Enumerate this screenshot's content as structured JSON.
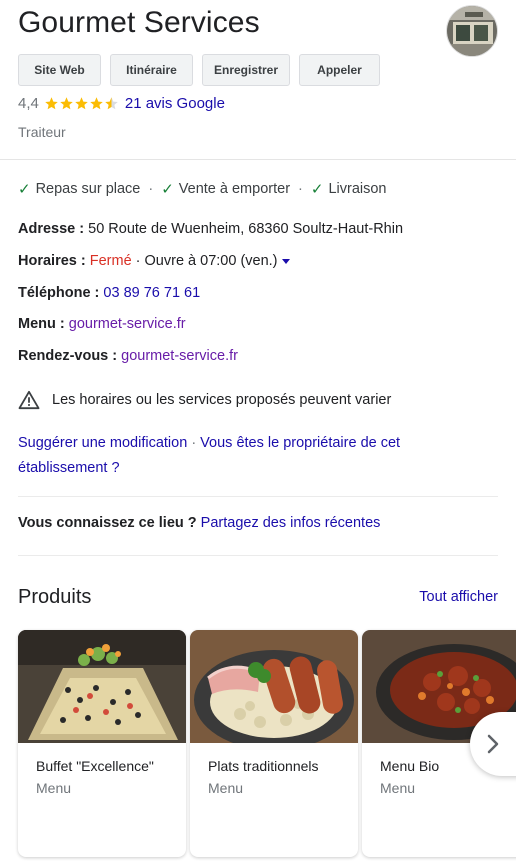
{
  "header": {
    "title": "Gourmet Services"
  },
  "actions": {
    "website": "Site Web",
    "directions": "Itinéraire",
    "save": "Enregistrer",
    "call": "Appeler"
  },
  "rating": {
    "value": "4,4",
    "stars": 4.4,
    "reviews_link": "21 avis Google"
  },
  "category": "Traiteur",
  "services": {
    "items": [
      "Repas sur place",
      "Vente à emporter",
      "Livraison"
    ]
  },
  "info": {
    "address_label": "Adresse : ",
    "address_value": "50 Route de Wuenheim, 68360 Soultz-Haut-Rhin",
    "hours_label": "Horaires : ",
    "hours_status": "Fermé",
    "hours_opens": " · Ouvre à 07:00 (ven.)",
    "phone_label": "Téléphone : ",
    "phone_value": "03 89 76 71 61",
    "menu_label": "Menu : ",
    "menu_value": "gourmet-service.fr",
    "appointment_label": "Rendez-vous : ",
    "appointment_value": "gourmet-service.fr"
  },
  "warning": "Les horaires ou les services proposés peuvent varier",
  "suggest": {
    "edit": "Suggérer une modification",
    "owner": "Vous êtes le propriétaire de cet établissement ?"
  },
  "know": {
    "question": "Vous connaissez ce lieu ?",
    "link": "Partagez des infos récentes"
  },
  "products": {
    "heading": "Produits",
    "see_all": "Tout afficher",
    "items": [
      {
        "name": "Buffet \"Excellence\"",
        "sub": "Menu"
      },
      {
        "name": "Plats traditionnels",
        "sub": "Menu"
      },
      {
        "name": "Menu Bio",
        "sub": "Menu"
      }
    ]
  },
  "colors": {
    "link": "#1a0dab",
    "visited": "#681da8",
    "closed": "#d93025",
    "check": "#188038",
    "star": "#fbbc04"
  }
}
